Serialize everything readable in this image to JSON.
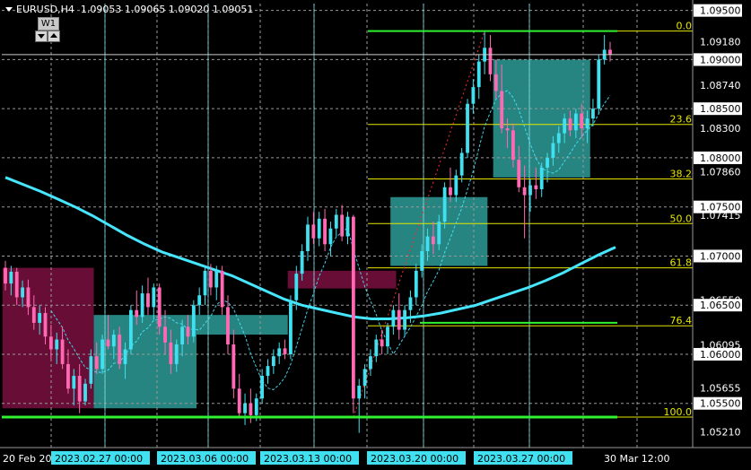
{
  "header": {
    "symbol": "EURUSD,H4",
    "open": "1.09053",
    "high": "1.09065",
    "low": "1.09020",
    "close": "1.09051"
  },
  "timeframe_button": {
    "label": "W1"
  },
  "colors": {
    "background": "#000000",
    "bull_candle": "#40E0F0",
    "bear_candle": "#FF69B4",
    "grid": "#9A9A9A",
    "fib": "#E6E600",
    "ma": "#46E6FF",
    "teal_box": "#2E9C98",
    "maroon_box": "#7A1040",
    "green_line": "#32F032",
    "vline": "#7EE0E6"
  },
  "price_axis": {
    "min": 1.0505,
    "max": 1.0957,
    "ticks": [
      "1.09500",
      "1.09180",
      "1.09000",
      "1.08740",
      "1.08500",
      "1.08300",
      "1.08000",
      "1.07860",
      "1.07500",
      "1.07415",
      "1.07000",
      "1.06550",
      "1.06500",
      "1.06095",
      "1.06000",
      "1.05655",
      "1.05500",
      "1.05210"
    ],
    "grid_levels": [
      "1.09500",
      "1.09000",
      "1.08500",
      "1.08000",
      "1.07500",
      "1.07000",
      "1.06500",
      "1.06000",
      "1.05500"
    ],
    "current_price": "1.09051",
    "current_marker": "1.09000"
  },
  "fib_levels": [
    {
      "label": "0.0",
      "price": 1.0929
    },
    {
      "label": "23.6",
      "price": 1.0834
    },
    {
      "label": "38.2",
      "price": 1.07785
    },
    {
      "label": "50.0",
      "price": 1.0733
    },
    {
      "label": "61.8",
      "price": 1.0688
    },
    {
      "label": "76.4",
      "price": 1.0629
    },
    {
      "label": "100.0",
      "price": 1.0536
    }
  ],
  "time_axis": {
    "labels": [
      "20 Feb 20",
      "2023.02.27 00:00",
      "2023.03.06 00:00",
      "2023.03.13 00:00",
      "2023.03.20 00:00",
      "2023.03.27 00:00",
      "30 Mar 12:00"
    ],
    "highlighted": [
      "2023.02.27 00:00",
      "2023.03.06 00:00",
      "2023.03.13 00:00",
      "2023.03.20 00:00",
      "2023.03.27 00:00"
    ]
  },
  "chart_data": {
    "type": "candlestick",
    "symbol": "EURUSD",
    "timeframe": "H4",
    "candles": [
      [
        1.0688,
        1.0695,
        1.0665,
        1.0672
      ],
      [
        1.0672,
        1.069,
        1.066,
        1.0684
      ],
      [
        1.0684,
        1.0688,
        1.065,
        1.0658
      ],
      [
        1.0658,
        1.0675,
        1.0648,
        1.0668
      ],
      [
        1.0668,
        1.0676,
        1.064,
        1.0648
      ],
      [
        1.0648,
        1.066,
        1.0625,
        1.0632
      ],
      [
        1.0632,
        1.065,
        1.062,
        1.0642
      ],
      [
        1.0642,
        1.0648,
        1.061,
        1.0618
      ],
      [
        1.0618,
        1.063,
        1.0595,
        1.0605
      ],
      [
        1.0605,
        1.0622,
        1.059,
        1.0615
      ],
      [
        1.0615,
        1.0628,
        1.0585,
        1.059
      ],
      [
        1.059,
        1.0605,
        1.056,
        1.0565
      ],
      [
        1.0565,
        1.0585,
        1.0548,
        1.0578
      ],
      [
        1.0578,
        1.059,
        1.054,
        1.0552
      ],
      [
        1.0552,
        1.0575,
        1.0548,
        1.057
      ],
      [
        1.057,
        1.0605,
        1.0565,
        1.0598
      ],
      [
        1.0598,
        1.0612,
        1.058,
        1.0585
      ],
      [
        1.0585,
        1.062,
        1.058,
        1.0615
      ],
      [
        1.0615,
        1.064,
        1.0605,
        1.0608
      ],
      [
        1.0608,
        1.0625,
        1.0595,
        1.062
      ],
      [
        1.062,
        1.0628,
        1.0585,
        1.059
      ],
      [
        1.059,
        1.0612,
        1.0575,
        1.0605
      ],
      [
        1.0605,
        1.065,
        1.06,
        1.0645
      ],
      [
        1.0645,
        1.0665,
        1.063,
        1.0638
      ],
      [
        1.0638,
        1.067,
        1.0632,
        1.0662
      ],
      [
        1.0662,
        1.0678,
        1.064,
        1.0648
      ],
      [
        1.0648,
        1.0672,
        1.0635,
        1.0668
      ],
      [
        1.0668,
        1.0672,
        1.062,
        1.0628
      ],
      [
        1.0628,
        1.0645,
        1.06,
        1.0612
      ],
      [
        1.0612,
        1.0625,
        1.058,
        1.059
      ],
      [
        1.059,
        1.0615,
        1.0582,
        1.061
      ],
      [
        1.061,
        1.0635,
        1.0598,
        1.0628
      ],
      [
        1.0628,
        1.064,
        1.061,
        1.0618
      ],
      [
        1.0618,
        1.0655,
        1.0612,
        1.065
      ],
      [
        1.065,
        1.0668,
        1.064,
        1.066
      ],
      [
        1.066,
        1.069,
        1.065,
        1.0685
      ],
      [
        1.0685,
        1.0692,
        1.066,
        1.0668
      ],
      [
        1.0668,
        1.069,
        1.0655,
        1.0685
      ],
      [
        1.0685,
        1.069,
        1.064,
        1.0648
      ],
      [
        1.0648,
        1.066,
        1.06,
        1.061
      ],
      [
        1.061,
        1.0625,
        1.0555,
        1.0565
      ],
      [
        1.0565,
        1.058,
        1.0535,
        1.054
      ],
      [
        1.054,
        1.056,
        1.0528,
        1.055
      ],
      [
        1.055,
        1.0565,
        1.053,
        1.0538
      ],
      [
        1.0538,
        1.056,
        1.0532,
        1.0555
      ],
      [
        1.0555,
        1.0585,
        1.055,
        1.0578
      ],
      [
        1.0578,
        1.0595,
        1.057,
        1.0588
      ],
      [
        1.0588,
        1.0605,
        1.058,
        1.0598
      ],
      [
        1.0598,
        1.0612,
        1.059,
        1.0606
      ],
      [
        1.0606,
        1.0615,
        1.0595,
        1.06
      ],
      [
        1.06,
        1.066,
        1.0595,
        1.0655
      ],
      [
        1.0655,
        1.069,
        1.0645,
        1.0682
      ],
      [
        1.0682,
        1.0712,
        1.0675,
        1.0705
      ],
      [
        1.0705,
        1.074,
        1.0695,
        1.0732
      ],
      [
        1.0732,
        1.0745,
        1.0712,
        1.0718
      ],
      [
        1.0718,
        1.0745,
        1.071,
        1.0738
      ],
      [
        1.0738,
        1.0748,
        1.0705,
        1.0712
      ],
      [
        1.0712,
        1.0735,
        1.07,
        1.0728
      ],
      [
        1.0728,
        1.0748,
        1.072,
        1.0742
      ],
      [
        1.0742,
        1.0752,
        1.0715,
        1.072
      ],
      [
        1.072,
        1.0745,
        1.0712,
        1.074
      ],
      [
        1.074,
        1.0742,
        1.054,
        1.0555
      ],
      [
        1.0555,
        1.0575,
        1.052,
        1.0568
      ],
      [
        1.0568,
        1.059,
        1.0555,
        1.0585
      ],
      [
        1.0585,
        1.0605,
        1.0578,
        1.0598
      ],
      [
        1.0598,
        1.062,
        1.0592,
        1.0615
      ],
      [
        1.0615,
        1.0625,
        1.06,
        1.0608
      ],
      [
        1.0608,
        1.0632,
        1.06,
        1.0628
      ],
      [
        1.0628,
        1.065,
        1.062,
        1.0645
      ],
      [
        1.0645,
        1.0662,
        1.0615,
        1.0625
      ],
      [
        1.0625,
        1.065,
        1.0618,
        1.0645
      ],
      [
        1.0645,
        1.0665,
        1.0632,
        1.0658
      ],
      [
        1.0658,
        1.0692,
        1.065,
        1.0685
      ],
      [
        1.0685,
        1.0712,
        1.0678,
        1.0705
      ],
      [
        1.0705,
        1.0728,
        1.0695,
        1.072
      ],
      [
        1.072,
        1.0735,
        1.0702,
        1.0712
      ],
      [
        1.0712,
        1.0742,
        1.0706,
        1.0735
      ],
      [
        1.0735,
        1.0775,
        1.0728,
        1.077
      ],
      [
        1.077,
        1.079,
        1.0755,
        1.0762
      ],
      [
        1.0762,
        1.0788,
        1.0755,
        1.0782
      ],
      [
        1.0782,
        1.081,
        1.0775,
        1.0805
      ],
      [
        1.0805,
        1.086,
        1.08,
        1.0855
      ],
      [
        1.0855,
        1.088,
        1.0845,
        1.0872
      ],
      [
        1.0872,
        1.0905,
        1.086,
        1.0898
      ],
      [
        1.0898,
        1.0929,
        1.0885,
        1.0912
      ],
      [
        1.0912,
        1.0925,
        1.0878,
        1.0885
      ],
      [
        1.0885,
        1.09,
        1.086,
        1.0868
      ],
      [
        1.0868,
        1.0895,
        1.0825,
        1.083
      ],
      [
        1.083,
        1.084,
        1.081,
        1.0828
      ],
      [
        1.0828,
        1.0835,
        1.079,
        1.0798
      ],
      [
        1.0798,
        1.0812,
        1.0765,
        1.077
      ],
      [
        1.077,
        1.0792,
        1.0718,
        1.0762
      ],
      [
        1.0762,
        1.0778,
        1.0745,
        1.0772
      ],
      [
        1.0772,
        1.079,
        1.0758,
        1.0768
      ],
      [
        1.0768,
        1.0795,
        1.076,
        1.079
      ],
      [
        1.079,
        1.0805,
        1.0775,
        1.08
      ],
      [
        1.08,
        1.0822,
        1.0792,
        1.0815
      ],
      [
        1.0815,
        1.0832,
        1.0805,
        1.0825
      ],
      [
        1.0825,
        1.0845,
        1.0815,
        1.084
      ],
      [
        1.084,
        1.0848,
        1.0822,
        1.0828
      ],
      [
        1.0828,
        1.085,
        1.082,
        1.0845
      ],
      [
        1.0845,
        1.0855,
        1.082,
        1.083
      ],
      [
        1.083,
        1.0848,
        1.0815,
        1.084
      ],
      [
        1.084,
        1.086,
        1.0832,
        1.085
      ],
      [
        1.085,
        1.0905,
        1.0845,
        1.09
      ],
      [
        1.09,
        1.0925,
        1.0895,
        1.091
      ],
      [
        1.091,
        1.0918,
        1.0898,
        1.0905
      ]
    ],
    "fib_retracement": {
      "high": 1.0929,
      "low": 1.0536
    },
    "ma_slow": [
      1.078,
      1.0773,
      1.0766,
      1.0758,
      1.075,
      1.0741,
      1.0731,
      1.0721,
      1.0712,
      1.0704,
      1.0698,
      1.0692,
      1.0686,
      1.068,
      1.0672,
      1.0664,
      1.0656,
      1.065,
      1.0646,
      1.0642,
      1.0638,
      1.0636,
      1.0636,
      1.0637,
      1.0639,
      1.0642,
      1.0646,
      1.065,
      1.0656,
      1.0662,
      1.0668,
      1.0675,
      1.0683,
      1.0692,
      1.0701,
      1.0709
    ],
    "zones": [
      {
        "type": "maroon",
        "from": 1.0545,
        "to": 1.0688
      },
      {
        "type": "teal",
        "from": 1.0545,
        "to": 1.064
      },
      {
        "type": "teal",
        "from": 1.062,
        "to": 1.064
      },
      {
        "type": "maroon",
        "from": 1.0667,
        "to": 1.0685
      },
      {
        "type": "teal",
        "from": 1.069,
        "to": 1.076
      },
      {
        "type": "teal",
        "from": 1.078,
        "to": 1.09
      }
    ]
  }
}
